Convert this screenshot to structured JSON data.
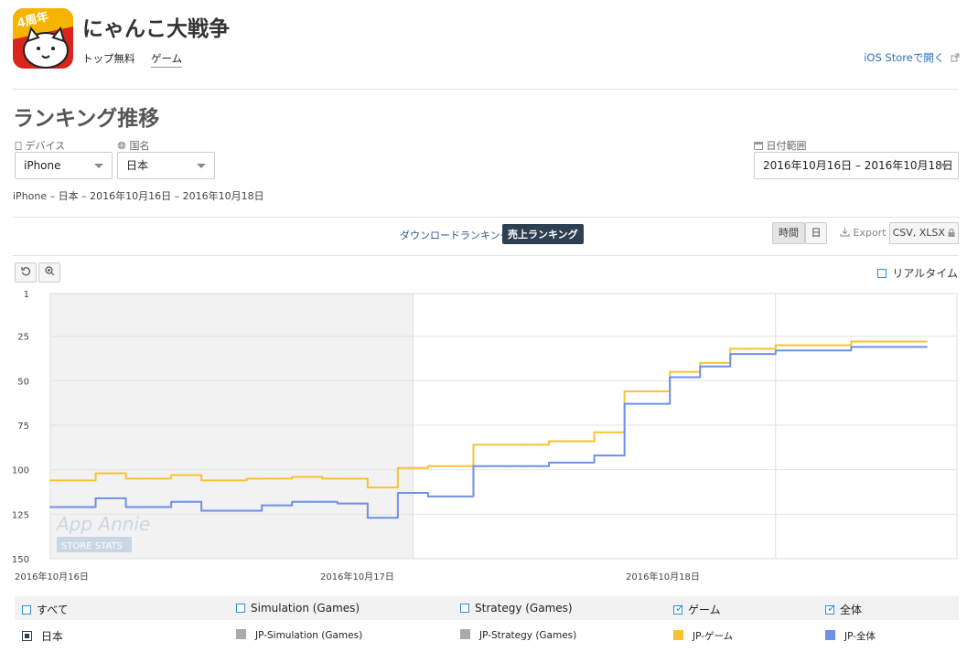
{
  "app": {
    "title": "にゃんこ大戦争",
    "icon_badge": "4周年",
    "tag_rank": "トップ無料",
    "tag_genre": "ゲーム",
    "store_link": "iOS Storeで開く"
  },
  "section_title": "ランキング推移",
  "filters": {
    "device_label": "デバイス",
    "device_value": "iPhone",
    "country_label": "国名",
    "country_value": "日本",
    "date_label": "日付範囲",
    "date_value": "2016年10月16日 – 2016年10月18日"
  },
  "summary": "iPhone – 日本 – 2016年10月16日 – 2016年10月18日",
  "tabs": {
    "download": "ダウンロードランキング",
    "sales": "売上ランキング"
  },
  "toolbar": {
    "hour": "時間",
    "day": "日",
    "export": "Export",
    "csv": "CSV, XLSX"
  },
  "realtime_label": "リアルタイム",
  "watermark": {
    "brand": "App Annie",
    "sub": "STORE STATS"
  },
  "legend": {
    "row1": [
      {
        "label": "すべて",
        "checked": false
      },
      {
        "label": "Simulation (Games)",
        "checked": false
      },
      {
        "label": "Strategy (Games)",
        "checked": false
      },
      {
        "label": "ゲーム",
        "checked": true
      },
      {
        "label": "全体",
        "checked": true
      }
    ],
    "row2": [
      {
        "label": "日本",
        "color": "#2f3f52"
      },
      {
        "label": "JP-Simulation (Games)",
        "color": "#aaaaaa"
      },
      {
        "label": "JP-Strategy (Games)",
        "color": "#aaaaaa"
      },
      {
        "label": "JP-ゲーム",
        "color": "#f9c232"
      },
      {
        "label": "JP-全体",
        "color": "#6f8fe8"
      }
    ]
  },
  "chart_data": {
    "type": "line",
    "y_axis": {
      "min": 1,
      "max": 150,
      "inverted": true,
      "ticks": [
        1,
        25,
        50,
        75,
        100,
        125,
        150
      ]
    },
    "x_ticks": [
      "2016年10月16日",
      "2016年10月17日",
      "2016年10月18日"
    ],
    "x_range_hours": [
      0,
      60
    ],
    "shaded_region_hours": [
      0,
      24
    ],
    "series": [
      {
        "name": "JP-ゲーム",
        "color": "#f9c232",
        "points": [
          [
            0,
            106
          ],
          [
            1,
            106
          ],
          [
            2,
            106
          ],
          [
            3,
            102
          ],
          [
            4,
            102
          ],
          [
            5,
            105
          ],
          [
            6,
            105
          ],
          [
            7,
            105
          ],
          [
            8,
            103
          ],
          [
            9,
            103
          ],
          [
            10,
            106
          ],
          [
            11,
            106
          ],
          [
            12,
            106
          ],
          [
            13,
            105
          ],
          [
            14,
            105
          ],
          [
            15,
            105
          ],
          [
            16,
            104
          ],
          [
            17,
            104
          ],
          [
            18,
            105
          ],
          [
            19,
            105
          ],
          [
            20,
            105
          ],
          [
            21,
            110
          ],
          [
            22,
            110
          ],
          [
            23,
            99
          ],
          [
            24,
            99
          ],
          [
            25,
            98
          ],
          [
            26,
            98
          ],
          [
            27,
            98
          ],
          [
            28,
            86
          ],
          [
            29,
            86
          ],
          [
            30,
            86
          ],
          [
            31,
            86
          ],
          [
            32,
            86
          ],
          [
            33,
            84
          ],
          [
            34,
            84
          ],
          [
            35,
            84
          ],
          [
            36,
            79
          ],
          [
            37,
            79
          ],
          [
            38,
            56
          ],
          [
            39,
            56
          ],
          [
            40,
            56
          ],
          [
            41,
            45
          ],
          [
            42,
            45
          ],
          [
            43,
            40
          ],
          [
            44,
            40
          ],
          [
            45,
            32
          ],
          [
            46,
            32
          ],
          [
            47,
            32
          ],
          [
            48,
            30
          ],
          [
            49,
            30
          ],
          [
            50,
            30
          ],
          [
            51,
            30
          ],
          [
            52,
            30
          ],
          [
            53,
            28
          ],
          [
            54,
            28
          ],
          [
            55,
            28
          ],
          [
            56,
            28
          ],
          [
            57,
            28
          ],
          [
            58,
            28
          ]
        ]
      },
      {
        "name": "JP-全体",
        "color": "#6f8fe8",
        "points": [
          [
            0,
            121
          ],
          [
            1,
            121
          ],
          [
            2,
            121
          ],
          [
            3,
            116
          ],
          [
            4,
            116
          ],
          [
            5,
            121
          ],
          [
            6,
            121
          ],
          [
            7,
            121
          ],
          [
            8,
            118
          ],
          [
            9,
            118
          ],
          [
            10,
            123
          ],
          [
            11,
            123
          ],
          [
            12,
            123
          ],
          [
            13,
            123
          ],
          [
            14,
            120
          ],
          [
            15,
            120
          ],
          [
            16,
            118
          ],
          [
            17,
            118
          ],
          [
            18,
            118
          ],
          [
            19,
            119
          ],
          [
            20,
            119
          ],
          [
            21,
            127
          ],
          [
            22,
            127
          ],
          [
            23,
            113
          ],
          [
            24,
            113
          ],
          [
            25,
            115
          ],
          [
            26,
            115
          ],
          [
            27,
            115
          ],
          [
            28,
            98
          ],
          [
            29,
            98
          ],
          [
            30,
            98
          ],
          [
            31,
            98
          ],
          [
            32,
            98
          ],
          [
            33,
            96
          ],
          [
            34,
            96
          ],
          [
            35,
            96
          ],
          [
            36,
            92
          ],
          [
            37,
            92
          ],
          [
            38,
            63
          ],
          [
            39,
            63
          ],
          [
            40,
            63
          ],
          [
            41,
            48
          ],
          [
            42,
            48
          ],
          [
            43,
            42
          ],
          [
            44,
            42
          ],
          [
            45,
            35
          ],
          [
            46,
            35
          ],
          [
            47,
            35
          ],
          [
            48,
            33
          ],
          [
            49,
            33
          ],
          [
            50,
            33
          ],
          [
            51,
            33
          ],
          [
            52,
            33
          ],
          [
            53,
            31
          ],
          [
            54,
            31
          ],
          [
            55,
            31
          ],
          [
            56,
            31
          ],
          [
            57,
            31
          ],
          [
            58,
            31
          ]
        ]
      }
    ]
  }
}
